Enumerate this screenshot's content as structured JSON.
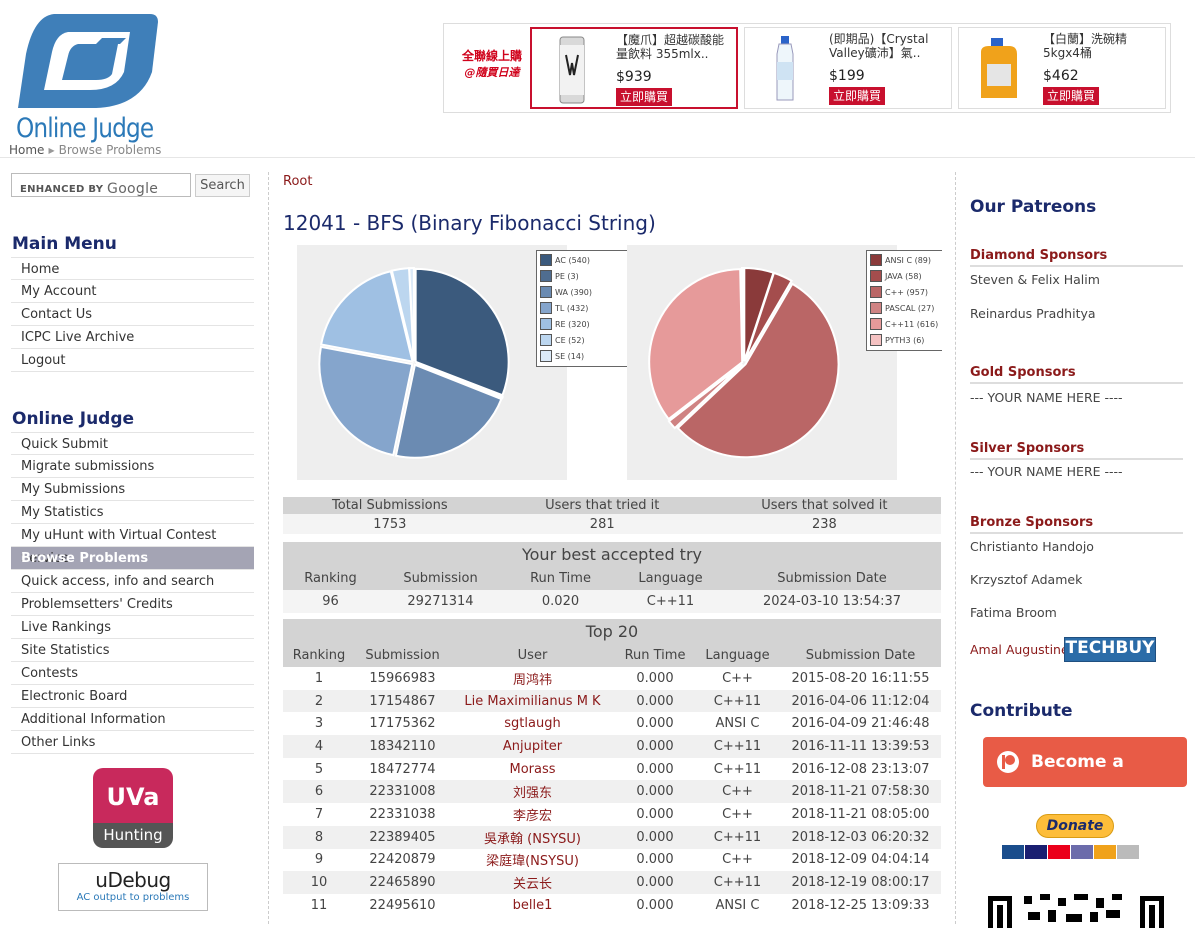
{
  "header": {
    "logo_text": "Online Judge",
    "breadcrumb": {
      "home": "Home",
      "current": "Browse Problems"
    }
  },
  "ad": {
    "brand_line1": "全聯線上購",
    "brand_line2": "@隨買日達",
    "items": [
      {
        "title": "【魔爪】超越碳酸能量飲料 355mlx..",
        "price": "$939",
        "buy": "立即購買"
      },
      {
        "title": "(即期品)【Crystal Valley礦沛】氣..",
        "price": "$199",
        "buy": "立即購買"
      },
      {
        "title": "【白蘭】洗碗精5kgx4桶",
        "price": "$462",
        "buy": "立即購買"
      }
    ]
  },
  "left": {
    "search_label": "ENHANCED BY",
    "search_google": "Google",
    "search_button": "Search",
    "main_menu_title": "Main Menu",
    "main_menu": [
      "Home",
      "My Account",
      "Contact Us",
      "ICPC Live Archive",
      "Logout"
    ],
    "oj_title": "Online Judge",
    "oj_menu": [
      "Quick Submit",
      "Migrate submissions",
      "My Submissions",
      "My Statistics",
      "My uHunt with Virtual Contest Service",
      "Browse Problems",
      "Quick access, info and search",
      "Problemsetters' Credits",
      "Live Rankings",
      "Site Statistics",
      "Contests",
      "Electronic Board",
      "Additional Information",
      "Other Links"
    ],
    "oj_active": "Browse Problems",
    "uva_top": "UVa",
    "uva_bottom": "Hunting",
    "udebug_title": "uDebug",
    "udebug_sub": "AC output to problems"
  },
  "main": {
    "root": "Root",
    "title": "12041 - BFS (Binary Fibonacci String)",
    "stats_headers": [
      "Total Submissions",
      "Users that tried it",
      "Users that solved it"
    ],
    "stats_values": [
      "1753",
      "281",
      "238"
    ],
    "best_caption": "Your best accepted try",
    "best_headers": [
      "Ranking",
      "Submission",
      "Run Time",
      "Language",
      "Submission Date"
    ],
    "best_row": [
      "96",
      "29271314",
      "0.020",
      "C++11",
      "2024-03-10 13:54:37"
    ],
    "top_caption": "Top 20",
    "top_headers": [
      "Ranking",
      "Submission",
      "User",
      "Run Time",
      "Language",
      "Submission Date"
    ],
    "top_rows": [
      [
        "1",
        "15966983",
        "周鸿祎",
        "0.000",
        "C++",
        "2015-08-20 16:11:55"
      ],
      [
        "2",
        "17154867",
        "Lie Maximilianus M K",
        "0.000",
        "C++11",
        "2016-04-06 11:12:04"
      ],
      [
        "3",
        "17175362",
        "sgtlaugh",
        "0.000",
        "ANSI C",
        "2016-04-09 21:46:48"
      ],
      [
        "4",
        "18342110",
        "Anjupiter",
        "0.000",
        "C++11",
        "2016-11-11 13:39:53"
      ],
      [
        "5",
        "18472774",
        "Morass",
        "0.000",
        "C++11",
        "2016-12-08 23:13:07"
      ],
      [
        "6",
        "22331008",
        "刘强东",
        "0.000",
        "C++",
        "2018-11-21 07:58:30"
      ],
      [
        "7",
        "22331038",
        "李彦宏",
        "0.000",
        "C++",
        "2018-11-21 08:05:00"
      ],
      [
        "8",
        "22389405",
        "吳承翰 (NSYSU)",
        "0.000",
        "C++11",
        "2018-12-03 06:20:32"
      ],
      [
        "9",
        "22420879",
        "梁庭瑋(NSYSU)",
        "0.000",
        "C++",
        "2018-12-09 04:04:14"
      ],
      [
        "10",
        "22465890",
        "关云长",
        "0.000",
        "C++11",
        "2018-12-19 08:00:17"
      ],
      [
        "11",
        "22495610",
        "belle1",
        "0.000",
        "ANSI C",
        "2018-12-25 13:09:33"
      ]
    ]
  },
  "chart_data": [
    {
      "type": "pie",
      "labels": [
        "AC",
        "PE",
        "WA",
        "TL",
        "RE",
        "CE",
        "SE"
      ],
      "values": [
        540,
        3,
        390,
        432,
        320,
        52,
        14
      ],
      "legend": [
        "AC (540)",
        "PE (3)",
        "WA (390)",
        "TL (432)",
        "RE (320)",
        "CE (52)",
        "SE (14)"
      ],
      "colors": [
        "#3b5a7d",
        "#4f6d90",
        "#6b8bb2",
        "#85a5cc",
        "#9fc0e3",
        "#bcd6ef",
        "#dceaf8"
      ],
      "legend_position": "top-right"
    },
    {
      "type": "pie",
      "labels": [
        "ANSI C",
        "JAVA",
        "C++",
        "PASCAL",
        "C++11",
        "PYTH3"
      ],
      "values": [
        89,
        58,
        957,
        27,
        616,
        6
      ],
      "legend": [
        "ANSI C (89)",
        "JAVA (58)",
        "C++ (957)",
        "PASCAL (27)",
        "C++11 (616)",
        "PYTH3 (6)"
      ],
      "colors": [
        "#8a3a3a",
        "#a44d4d",
        "#ba6666",
        "#cf8383",
        "#e69a9a",
        "#f5c2c2"
      ],
      "legend_position": "top-right"
    }
  ],
  "right": {
    "patreons_title": "Our Patreons",
    "diamond_title": "Diamond Sponsors",
    "diamond": [
      "Steven & Felix Halim",
      "Reinardus Pradhitya"
    ],
    "gold_title": "Gold Sponsors",
    "gold": [
      "--- YOUR NAME HERE ----"
    ],
    "silver_title": "Silver Sponsors",
    "silver": [
      "--- YOUR NAME HERE ----"
    ],
    "bronze_title": "Bronze Sponsors",
    "bronze": [
      "Christianto Handojo",
      "Krzysztof Adamek",
      "Fatima Broom",
      "Amal Augustine"
    ],
    "techbuy": "TECHBUY",
    "contribute_title": "Contribute",
    "patron_button": "Become a patron",
    "donate_button": "Donate"
  }
}
